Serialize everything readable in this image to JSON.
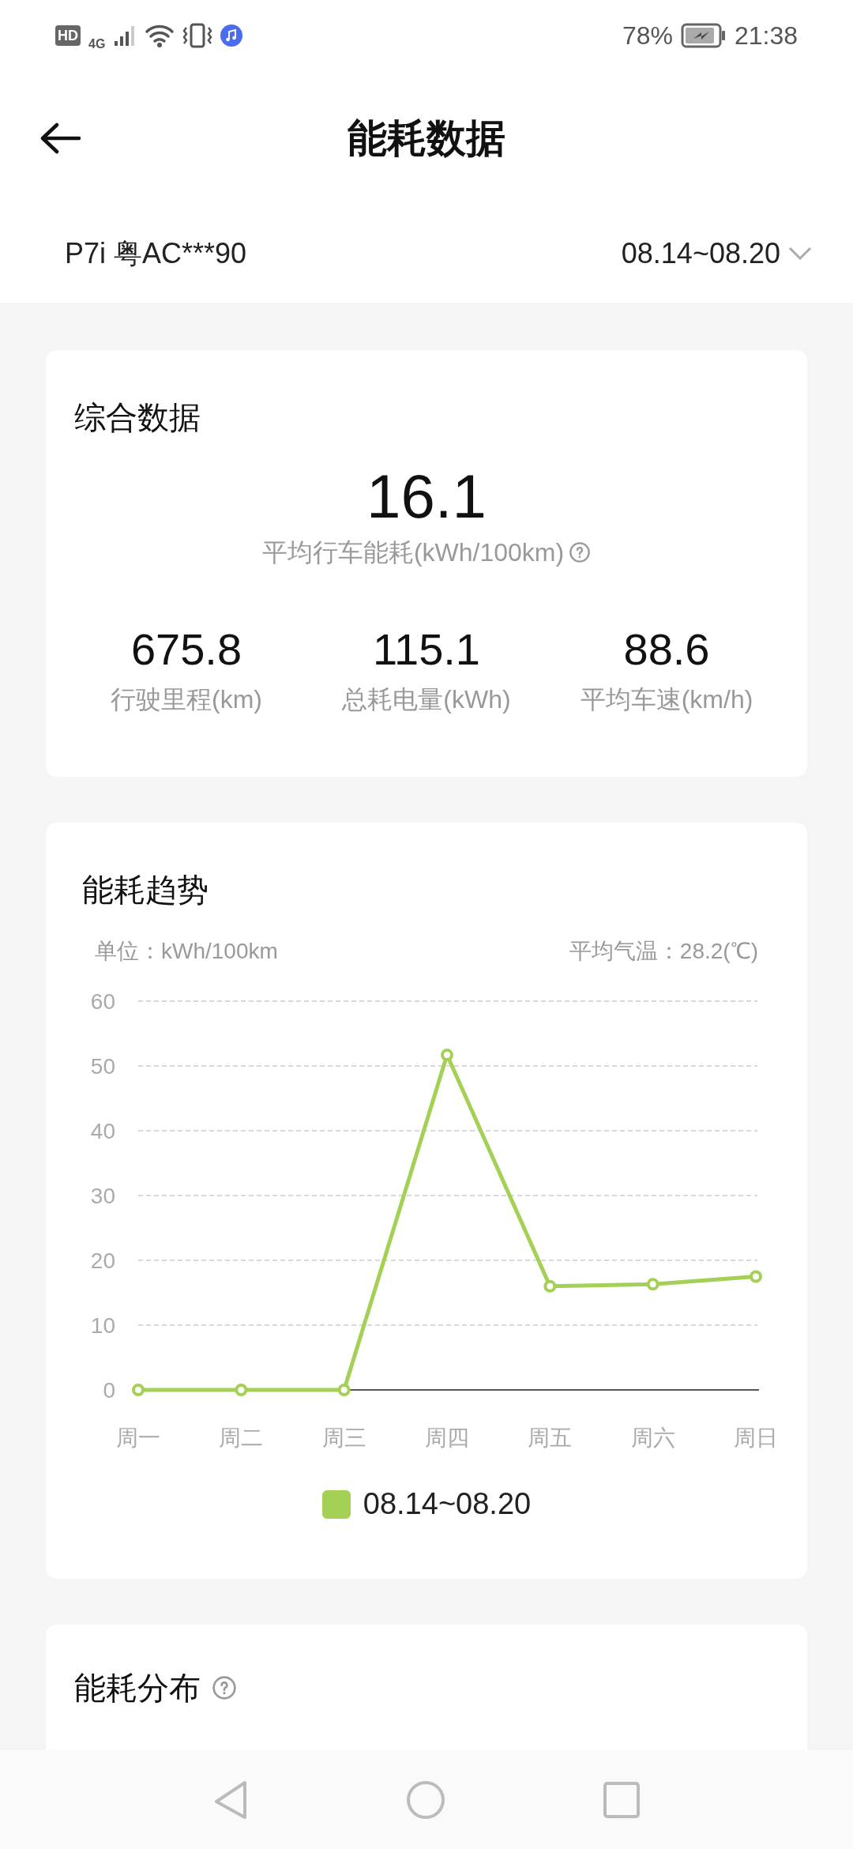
{
  "status_bar": {
    "hd": "HD",
    "network": "4G",
    "battery": "78%",
    "time": "21:38"
  },
  "header": {
    "title": "能耗数据"
  },
  "vehicle": {
    "name": "P7i 粤AC***90",
    "date_range": "08.14~08.20"
  },
  "summary": {
    "title": "综合数据",
    "main_value": "16.1",
    "main_label": "平均行车能耗(kWh/100km)",
    "stats": [
      {
        "value": "675.8",
        "label": "行驶里程(km)"
      },
      {
        "value": "115.1",
        "label": "总耗电量(kWh)"
      },
      {
        "value": "88.6",
        "label": "平均车速(km/h)"
      }
    ]
  },
  "trend": {
    "title": "能耗趋势",
    "unit": "单位：kWh/100km",
    "temperature": "平均气温：28.2(℃)",
    "chart_data": {
      "type": "line",
      "categories": [
        "周一",
        "周二",
        "周三",
        "周四",
        "周五",
        "周六",
        "周日"
      ],
      "ylim": [
        0,
        60
      ],
      "grid": true,
      "yticks": [
        0,
        10,
        20,
        30,
        40,
        50,
        60
      ],
      "series": [
        {
          "name": "08.14~08.20",
          "color": "#a4d055",
          "marker": true,
          "values": [
            0,
            0,
            0,
            51.7,
            16,
            16.3,
            17.5
          ]
        }
      ]
    }
  },
  "distribution": {
    "title": "能耗分布"
  }
}
